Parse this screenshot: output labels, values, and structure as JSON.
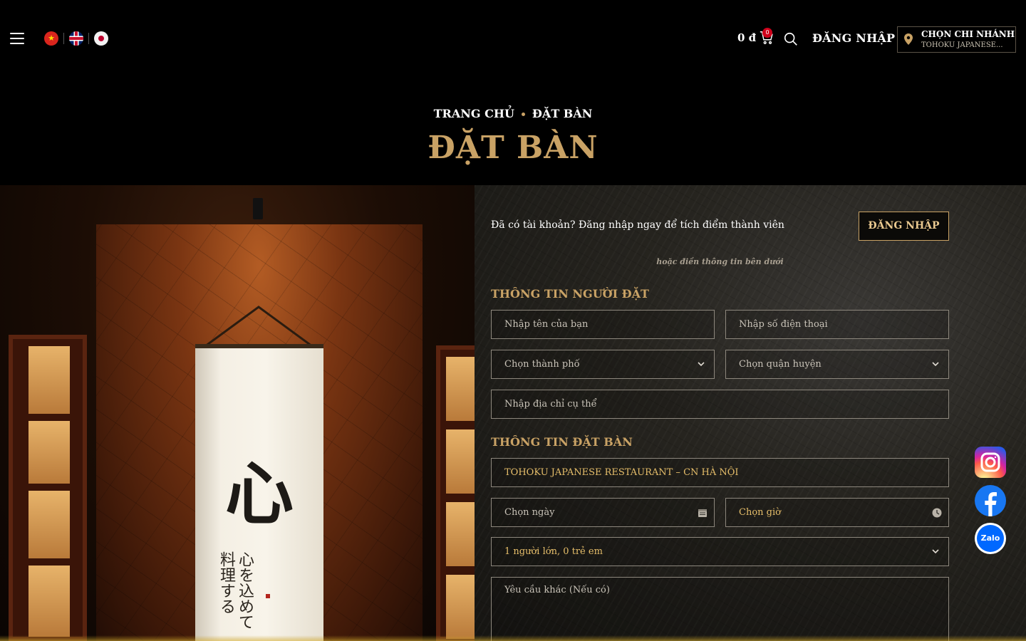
{
  "header": {
    "languages": [
      "vi",
      "en",
      "ja"
    ],
    "cart": {
      "price": "0 đ",
      "count": "0"
    },
    "login_label": "ĐĂNG NHẬP",
    "branch": {
      "title": "CHỌN CHI NHÁNH",
      "selected": "TOHOKU JAPANESE..."
    }
  },
  "breadcrumb": {
    "home": "TRANG CHỦ",
    "current": "ĐẶT BÀN"
  },
  "page_title": "ĐẶT BÀN",
  "form": {
    "prompt": "Đã có tài khoản? Đăng nhập ngay để tích điểm thành viên",
    "login_button": "ĐĂNG NHẬP",
    "or_text": "hoặc điền thông tin bên dưới",
    "section_customer": "THÔNG TIN NGƯỜI ĐẶT",
    "name_placeholder": "Nhập tên của bạn",
    "phone_placeholder": "Nhập số điện thoại",
    "city_placeholder": "Chọn thành phố",
    "district_placeholder": "Chọn quận huyện",
    "address_placeholder": "Nhập địa chỉ cụ thể",
    "section_booking": "THÔNG TIN ĐẶT BÀN",
    "branch_value": "TOHOKU JAPANESE RESTAURANT – CN HÀ NỘI",
    "date_placeholder": "Chọn ngày",
    "time_placeholder": "Chọn giờ",
    "guests_value": "1 người lớn, 0 trẻ em",
    "notes_placeholder": "Yêu cầu khác (Nếu có)"
  },
  "photo": {
    "kanji_big": "心",
    "kanji_small": "心を込めて料理する"
  },
  "social": {
    "zalo_label": "Zalo"
  },
  "colors": {
    "accent_gold": "#c9a265",
    "background": "#000000",
    "field_border": "#8d877d"
  }
}
